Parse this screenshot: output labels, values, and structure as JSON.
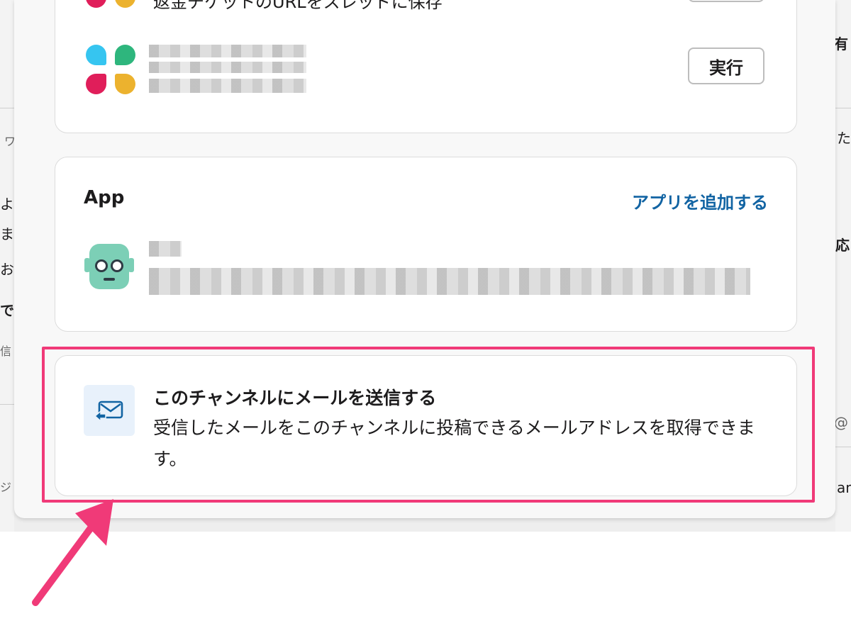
{
  "background": {
    "right_fragments": [
      "有",
      "た",
      "応",
      "@",
      "an"
    ],
    "left_fragments": [
      "ワ",
      "よ",
      "ま",
      "お",
      "で",
      "信",
      "ジ"
    ]
  },
  "top_card": {
    "partial_title": "返金チケットのURLをスレッドに保存",
    "run_button_label": "実行"
  },
  "app_section": {
    "heading": "App",
    "add_app_link": "アプリを追加する"
  },
  "email_section": {
    "title": "このチャンネルにメールを送信する",
    "description": "受信したメールをこのチャンネルに投稿できるメールアドレスを取得できます。"
  },
  "colors": {
    "accent_link": "#1264a3",
    "highlight": "#f03a78",
    "robot": "#7ccfb6"
  },
  "icons": {
    "workflow_icon": "slack-logo-icon",
    "app_icon": "robot-icon",
    "email_icon": "email-forward-icon"
  }
}
